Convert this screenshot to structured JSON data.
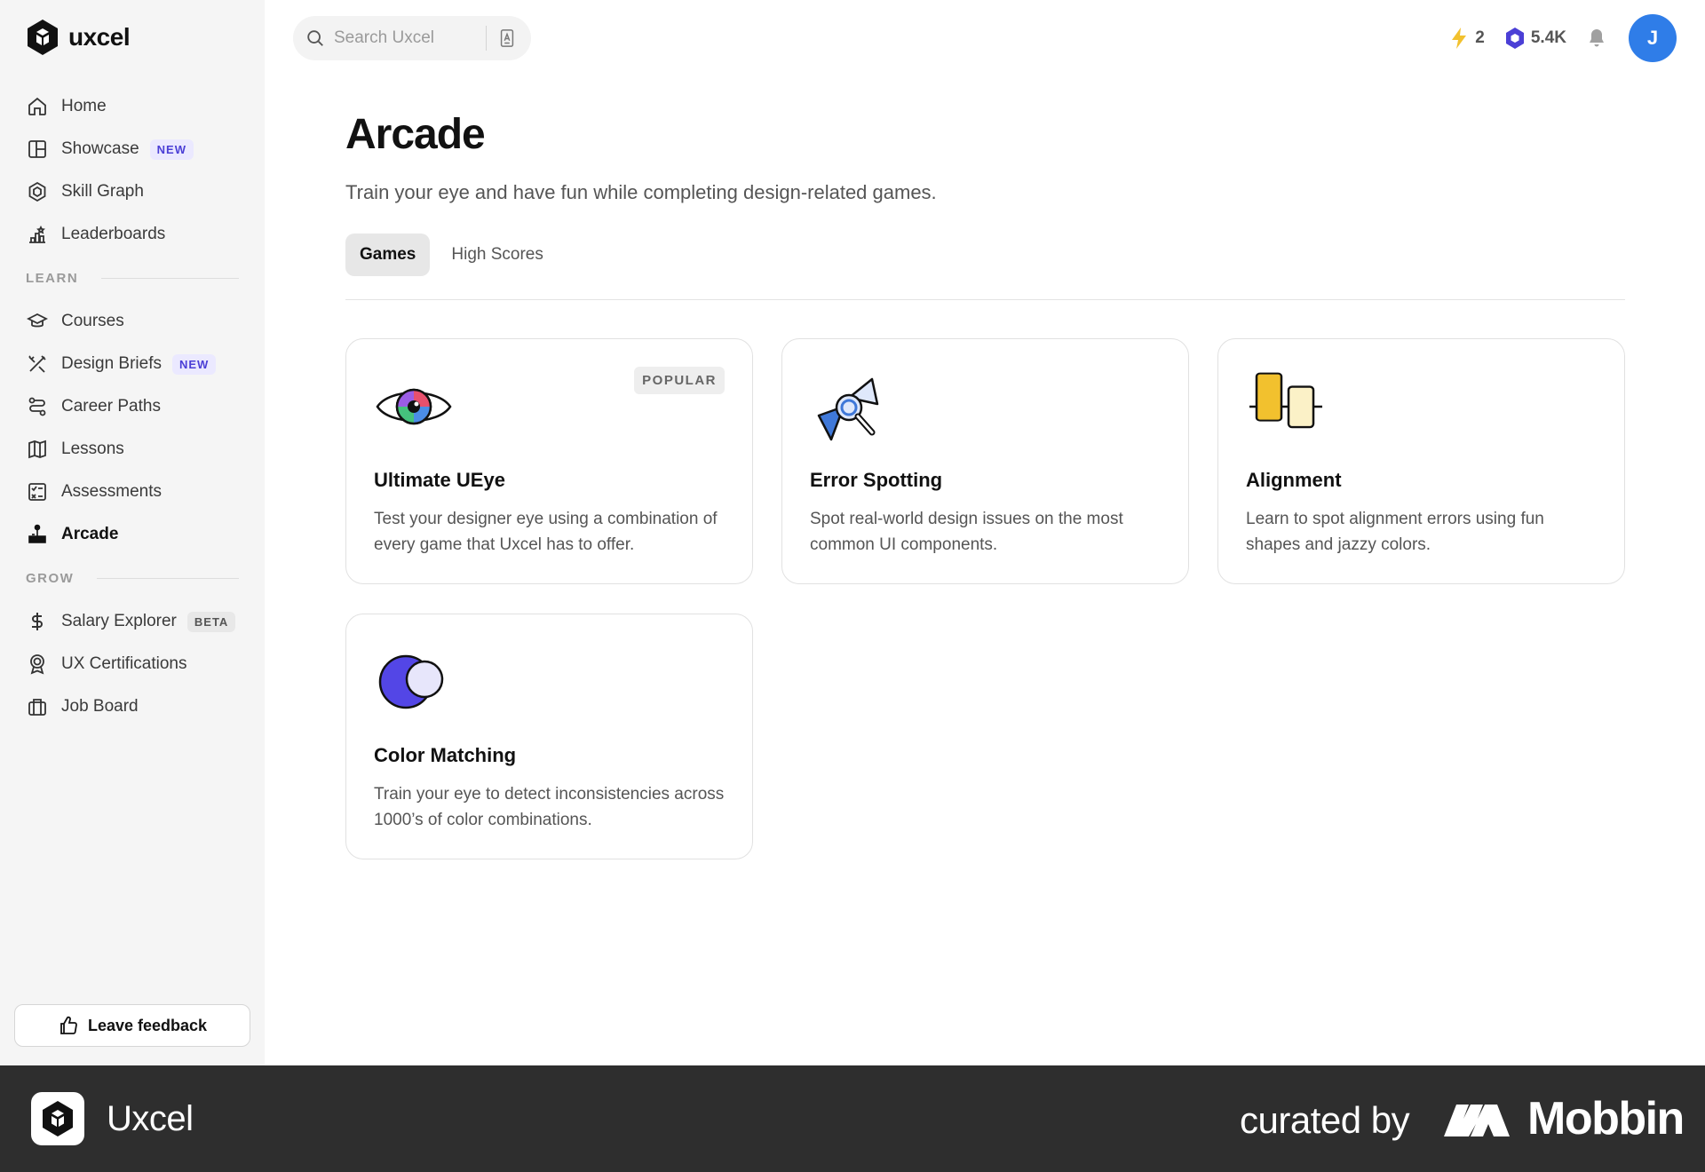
{
  "brand": {
    "name": "uxcel"
  },
  "sidebar": {
    "items_top": [
      {
        "label": "Home",
        "icon": "home-icon"
      },
      {
        "label": "Showcase",
        "icon": "showcase-icon",
        "badge": "NEW"
      },
      {
        "label": "Skill Graph",
        "icon": "skill-graph-icon"
      },
      {
        "label": "Leaderboards",
        "icon": "leaderboards-icon"
      }
    ],
    "section_learn": "LEARN",
    "items_learn": [
      {
        "label": "Courses",
        "icon": "courses-icon"
      },
      {
        "label": "Design Briefs",
        "icon": "design-briefs-icon",
        "badge": "NEW"
      },
      {
        "label": "Career Paths",
        "icon": "career-paths-icon"
      },
      {
        "label": "Lessons",
        "icon": "lessons-icon"
      },
      {
        "label": "Assessments",
        "icon": "assessments-icon"
      },
      {
        "label": "Arcade",
        "icon": "arcade-icon",
        "active": true
      }
    ],
    "section_grow": "GROW",
    "items_grow": [
      {
        "label": "Salary Explorer",
        "icon": "dollar-icon",
        "badge": "BETA"
      },
      {
        "label": "UX Certifications",
        "icon": "certification-icon"
      },
      {
        "label": "Job Board",
        "icon": "briefcase-icon"
      }
    ],
    "feedback_label": "Leave feedback"
  },
  "topbar": {
    "search_placeholder": "Search Uxcel",
    "streak": "2",
    "xp": "5.4K",
    "avatar_initial": "J",
    "colors": {
      "streak": "#f2c12e",
      "xp": "#4b3fd6",
      "avatar": "#2f7de8"
    }
  },
  "main": {
    "title": "Arcade",
    "subtitle": "Train your eye and have fun while completing design-related games.",
    "tabs": [
      {
        "label": "Games",
        "active": true
      },
      {
        "label": "High Scores",
        "active": false
      }
    ],
    "games": [
      {
        "title": "Ultimate UEye",
        "description": "Test your designer eye using a combination of every game that Uxcel has to offer.",
        "tag": "POPULAR",
        "icon": "eye-icon"
      },
      {
        "title": "Error Spotting",
        "description": "Spot real-world design issues on the most common UI components.",
        "icon": "magnifier-icon"
      },
      {
        "title": "Alignment",
        "description": "Learn to spot alignment errors using fun shapes and jazzy colors.",
        "icon": "alignment-icon"
      },
      {
        "title": "Color Matching",
        "description": "Train your eye to detect inconsistencies across 1000’s of color combinations.",
        "icon": "color-circles-icon"
      }
    ]
  },
  "footer": {
    "brand": "Uxcel",
    "curated_by": "curated by",
    "mobbin": "Mobbin"
  }
}
